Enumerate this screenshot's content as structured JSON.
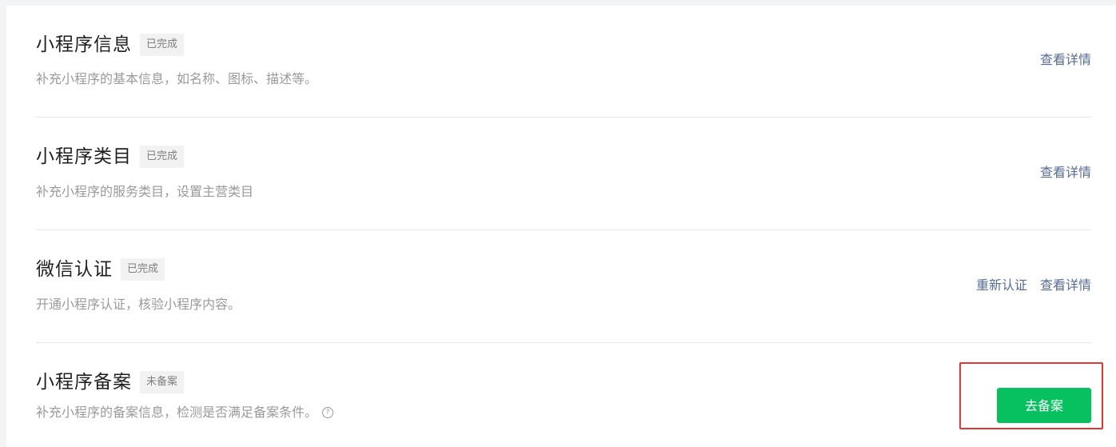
{
  "sections": [
    {
      "title": "小程序信息",
      "badge": "已完成",
      "description": "补充小程序的基本信息，如名称、图标、描述等。",
      "actions": [
        "查看详情"
      ]
    },
    {
      "title": "小程序类目",
      "badge": "已完成",
      "description": "补充小程序的服务类目，设置主营类目",
      "actions": [
        "查看详情"
      ]
    },
    {
      "title": "微信认证",
      "badge": "已完成",
      "description": "开通小程序认证，核验小程序内容。",
      "actions": [
        "重新认证",
        "查看详情"
      ]
    },
    {
      "title": "小程序备案",
      "badge": "未备案",
      "description": "补充小程序的备案信息，检测是否满足备案条件。",
      "help_icon": "question-circle-icon",
      "button_label": "去备案"
    }
  ],
  "help_glyph": "?",
  "colors": {
    "link": "#576b95",
    "primary_button": "#07c160",
    "highlight_box": "#e03636"
  }
}
